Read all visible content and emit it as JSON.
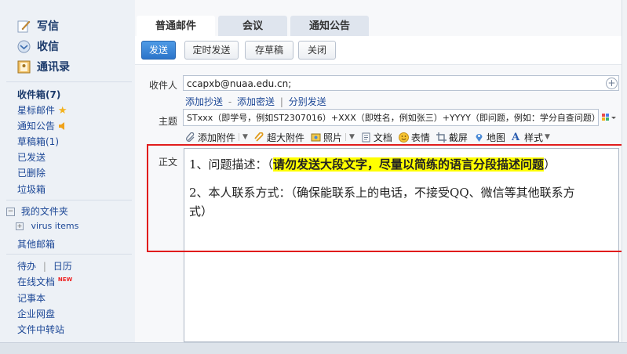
{
  "sidebar": {
    "compose": "写信",
    "inbox": "收信",
    "contacts": "通讯录",
    "folders": [
      {
        "label": "收件箱(7)",
        "bold": true
      },
      {
        "label": "星标邮件",
        "badge": "★"
      },
      {
        "label": "通知公告"
      },
      {
        "label": "草稿箱(1)"
      },
      {
        "label": "已发送"
      },
      {
        "label": "已删除"
      },
      {
        "label": "垃圾箱"
      }
    ],
    "my_folders": "我的文件夹",
    "virus_items": "virus items",
    "other_mail": "其他邮箱",
    "todo": "待办",
    "calendar": "日历",
    "online_docs": "在线文档",
    "new_badge": "NEW",
    "notes": "记事本",
    "netdisk": "企业网盘",
    "transfer": "文件中转站"
  },
  "tabs": [
    "普通邮件",
    "会议",
    "通知公告"
  ],
  "toolbar": {
    "send": "发送",
    "schedule": "定时发送",
    "save_draft": "存草稿",
    "close": "关闭"
  },
  "form": {
    "to_label": "收件人",
    "to_value": "ccapxb@nuaa.edu.cn;",
    "add_cc": "添加抄送",
    "add_bcc": "添加密送",
    "separate": "分别发送",
    "subject_label": "主题",
    "subject_value": "STxxx（即学号，例如ST2307016）+XXX（即姓名，例如张三）+YYYY（即问题，例如：学分自查问题）",
    "body_label": "正文"
  },
  "editor_toolbar": [
    "添加附件",
    "超大附件",
    "照片",
    "文档",
    "表情",
    "截屏",
    "地图",
    "样式"
  ],
  "body": {
    "line1_prefix": "1、问题描述：（",
    "line1_highlight": "请勿发送大段文字，尽量以简练的语言分段描述问题",
    "line1_suffix": "）",
    "line2a": "2、本人联系方式：（确保能联系上的电话，不接受QQ、微信等其他联系方",
    "line2b": "式）"
  },
  "colors": {
    "accent": "#2b74c9",
    "highlight": "#ffff00",
    "annotation": "#e11c1c",
    "link": "#1c4796"
  }
}
